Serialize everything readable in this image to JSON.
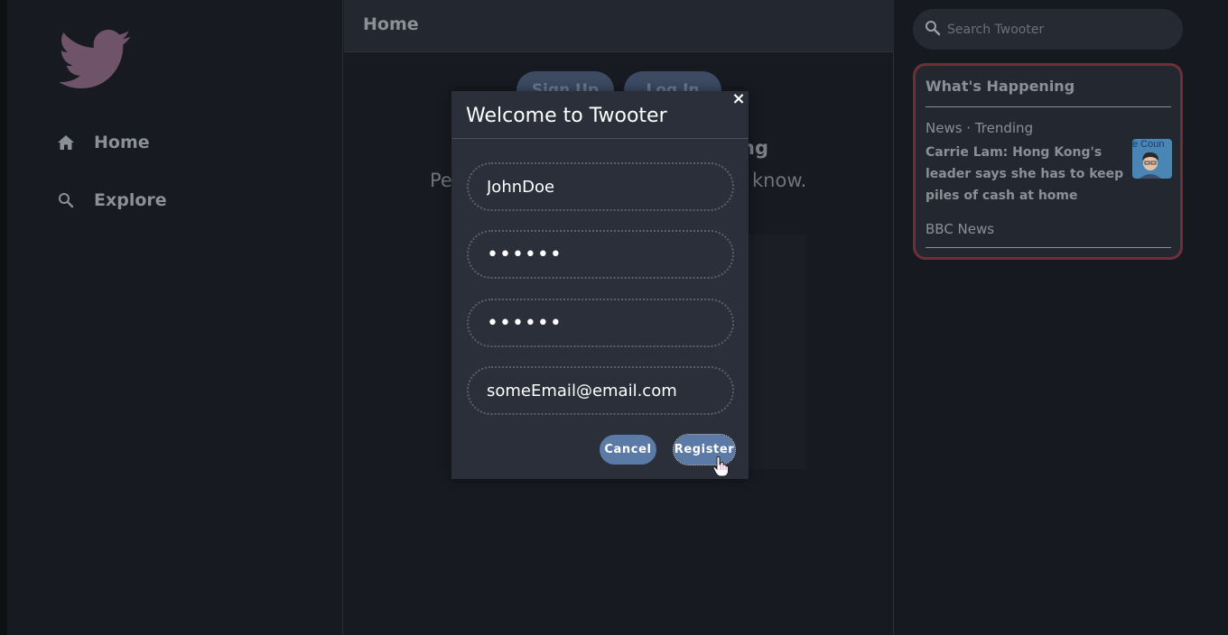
{
  "sidebar": {
    "logo_icon": "twitter-bird-icon",
    "nav": [
      {
        "label": "Home",
        "icon": "home-icon"
      },
      {
        "label": "Explore",
        "icon": "search-icon"
      }
    ]
  },
  "main": {
    "title": "Home",
    "signup_label": "Sign Up",
    "login_label": "Log In",
    "heading_fragment": "ng",
    "sub_left": "Pe",
    "sub_right": "know."
  },
  "search": {
    "placeholder": "Search Twooter"
  },
  "trends": {
    "title": "What's Happening",
    "items": [
      {
        "meta": "News · Trending",
        "headline": "Carrie Lam: Hong Kong's leader says she has to keep piles of cash at home",
        "thumb_text": "e Coun",
        "source": "BBC News"
      }
    ]
  },
  "modal": {
    "title": "Welcome to Twooter",
    "close": "×",
    "username": "JohnDoe",
    "password": "••••••",
    "confirm_password": "••••••",
    "email": "someEmail@email.com",
    "cancel_label": "Cancel",
    "register_label": "Register"
  },
  "colors": {
    "accent": "#5b7aa6",
    "trend_border": "#6e2f36",
    "logo": "#7a5a72"
  }
}
